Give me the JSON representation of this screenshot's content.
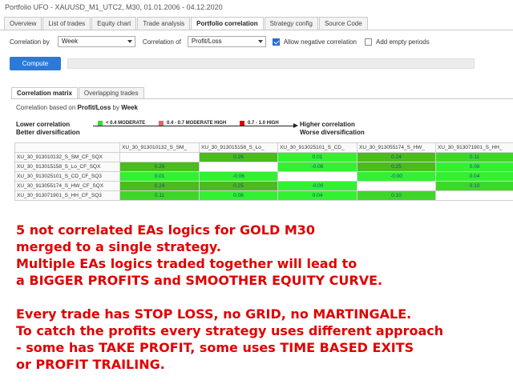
{
  "window": {
    "title": "Portfolio UFO - XAUUSD_M1_UTC2, M30, 01.01.2006 - 04.12.2020"
  },
  "tabs": [
    {
      "label": "Overview",
      "active": false
    },
    {
      "label": "List of trades",
      "active": false
    },
    {
      "label": "Equity chart",
      "active": false
    },
    {
      "label": "Trade analysis",
      "active": false
    },
    {
      "label": "Portfolio correlation",
      "active": true
    },
    {
      "label": "Strategy config",
      "active": false
    },
    {
      "label": "Source Code",
      "active": false
    }
  ],
  "controls": {
    "correlation_by_label": "Correlation by",
    "correlation_by_value": "Week",
    "correlation_of_label": "Correlation of",
    "correlation_of_value": "Profit/Loss",
    "allow_negative_label": "Allow negative correlation",
    "allow_negative_checked": true,
    "add_empty_label": "Add empty periods",
    "add_empty_checked": false,
    "compute_label": "Compute",
    "progress": 0.0
  },
  "subtabs": [
    {
      "label": "Correlation matrix",
      "active": true
    },
    {
      "label": "Overlapping trades",
      "active": false
    }
  ],
  "based_on": {
    "prefix": "Correlation based on ",
    "metric": "Profit/Loss",
    "mid": " by ",
    "period": "Week"
  },
  "legend": {
    "lower_line1": "Lower correlation",
    "lower_line2": "Better diversification",
    "higher_line1": "Higher correlation",
    "higher_line2": "Worse diversification",
    "items": [
      {
        "label": "< 0.4 MODERATE",
        "color": "#33dd33"
      },
      {
        "label": "0.4 - 0.7 MODERATE HIGH",
        "color": "#e06666"
      },
      {
        "label": "0.7 - 1.0 HIGH",
        "color": "#dd0000"
      }
    ]
  },
  "matrix": {
    "columns": [
      "XU_30_913010132_S_SM_",
      "XU_30_913015158_S_Lo_",
      "XU_30_913025101_S_CD_",
      "XU_30_913055174_S_HW_",
      "XU_30_913071901_S_HH_"
    ],
    "rows": [
      {
        "name": "XU_30_913010132_S_SM_CF_SQX",
        "cells": [
          "",
          "0.26",
          "0.01",
          "0.24",
          "0.11"
        ]
      },
      {
        "name": "XU_30_913015158_S_Lo_CF_SQX",
        "cells": [
          "0.26",
          "",
          "-0.06",
          "0.25",
          "0.08"
        ]
      },
      {
        "name": "XU_30_913025101_S_CD_CF_SQ3",
        "cells": [
          "0.01",
          "-0.06",
          "",
          "-0.00",
          "0.04"
        ]
      },
      {
        "name": "XU_30_913055174_S_HW_CF_SQX",
        "cells": [
          "0.24",
          "0.25",
          "-0.00",
          "",
          "0.10"
        ]
      },
      {
        "name": "XU_30_913071901_S_HH_CF_SQ3",
        "cells": [
          "0.11",
          "0.08",
          "0.04",
          "0.10",
          ""
        ]
      }
    ]
  },
  "promo": {
    "line1": "5 not correlated EAs logics for GOLD M30",
    "line2": "merged to a single strategy.",
    "line3": "Multiple EAs logics traded together will lead to",
    "line4": "a BIGGER PROFITS and SMOOTHER EQUITY CURVE.",
    "line5": "Every trade has STOP LOSS, no GRID, no MARTINGALE.",
    "line6": "To catch the profits every strategy uses different approach",
    "line7": "- some has TAKE PROFIT, some uses TIME BASED EXITS",
    "line8": "or PROFIT TRAILING."
  }
}
